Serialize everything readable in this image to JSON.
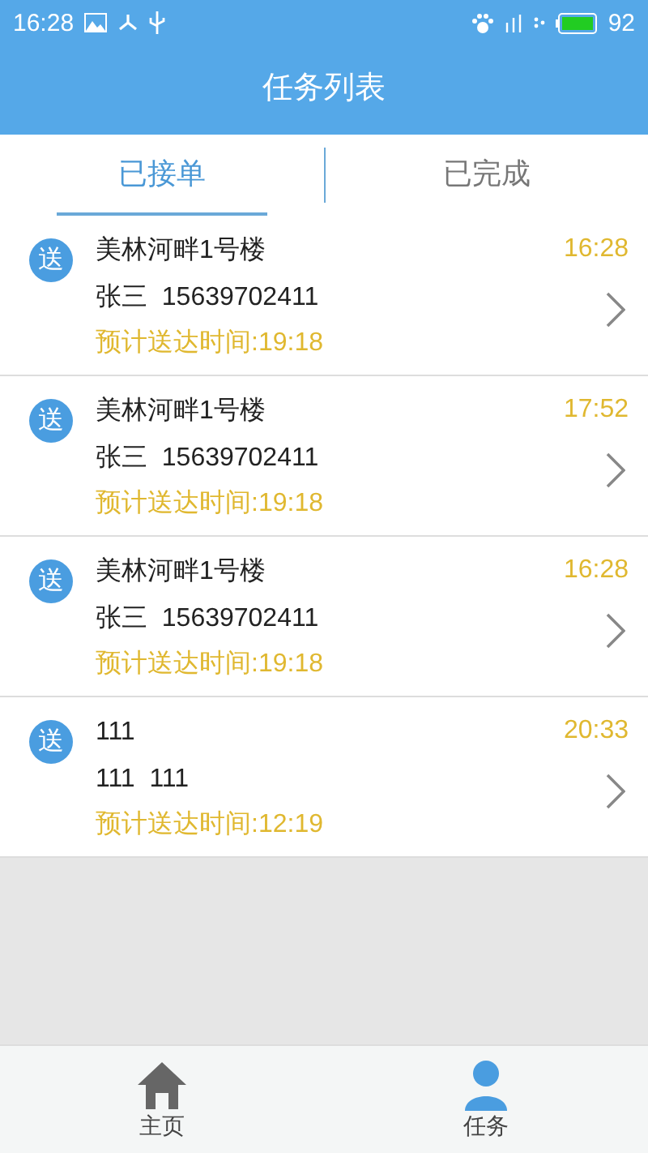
{
  "status_bar": {
    "time": "16:28",
    "battery": "92"
  },
  "header": {
    "title": "任务列表"
  },
  "tabs": [
    {
      "label": "已接单",
      "selected": true
    },
    {
      "label": "已完成",
      "selected": false
    }
  ],
  "orders": [
    {
      "badge": "送",
      "address": "美林河畔1号楼",
      "contact": "张三  15639702411",
      "eta": "预计送达时间:19:18",
      "time": "16:28"
    },
    {
      "badge": "送",
      "address": "美林河畔1号楼",
      "contact": "张三  15639702411",
      "eta": "预计送达时间:19:18",
      "time": "17:52"
    },
    {
      "badge": "送",
      "address": "美林河畔1号楼",
      "contact": "张三  15639702411",
      "eta": "预计送达时间:19:18",
      "time": "16:28"
    },
    {
      "badge": "送",
      "address": "111",
      "contact": "111  111",
      "eta": "预计送达时间:12:19",
      "time": "20:33"
    }
  ],
  "bottom_nav": [
    {
      "kind": "home",
      "label": "主页",
      "selected": false
    },
    {
      "kind": "person",
      "label": "任务",
      "selected": true
    }
  ]
}
